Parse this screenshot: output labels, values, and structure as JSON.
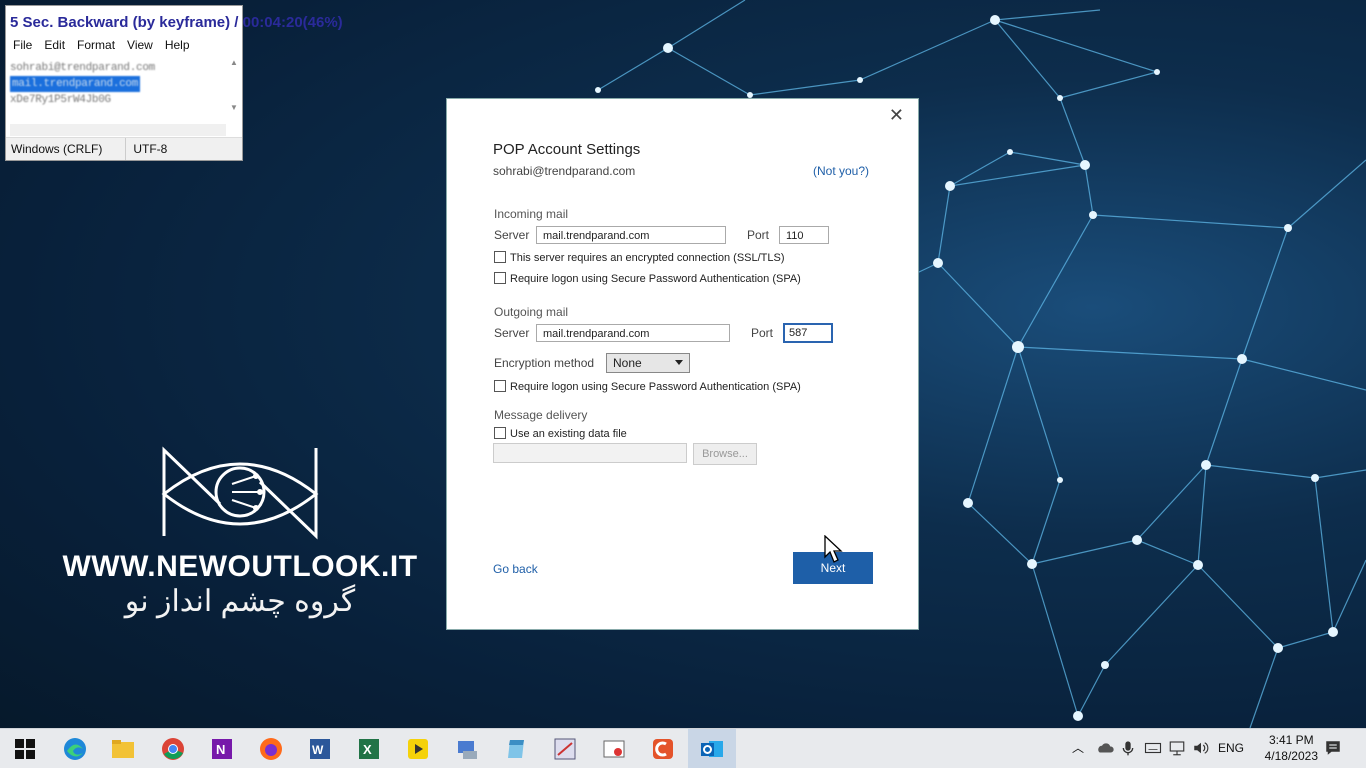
{
  "osd": {
    "text": "5 Sec. Backward (by keyframe) / 00:04:20(46%)"
  },
  "notepad": {
    "menu": [
      "File",
      "Edit",
      "Format",
      "View",
      "Help"
    ],
    "lines": [
      "sohrabi@trendparand.com",
      "mail.trendparand.com",
      "xDe7Ry1P5rW4Jb0G"
    ],
    "status_eol": "Windows (CRLF)",
    "status_encoding": "UTF-8"
  },
  "branding": {
    "url": "WWW.NEWOUTLOOK.IT",
    "tagline": "گروه چشم انداز نو"
  },
  "dialog": {
    "title": "POP Account Settings",
    "email": "sohrabi@trendparand.com",
    "not_you": "(Not you?)",
    "incoming": {
      "heading": "Incoming mail",
      "server_label": "Server",
      "server_value": "mail.trendparand.com",
      "port_label": "Port",
      "port_value": "110",
      "ssl_label": "This server requires an encrypted connection (SSL/TLS)",
      "ssl_checked": false,
      "spa_label": "Require logon using Secure Password Authentication (SPA)",
      "spa_checked": false
    },
    "outgoing": {
      "heading": "Outgoing mail",
      "server_label": "Server",
      "server_value": "mail.trendparand.com",
      "port_label": "Port",
      "port_value": "587",
      "encryption_label": "Encryption method",
      "encryption_value": "None",
      "spa_label": "Require logon using Secure Password Authentication (SPA)",
      "spa_checked": false
    },
    "delivery": {
      "heading": "Message delivery",
      "existing_label": "Use an existing data file",
      "existing_checked": false,
      "path_value": "",
      "browse_label": "Browse..."
    },
    "go_back": "Go back",
    "next": "Next"
  },
  "taskbar": {
    "apps": [
      "start-icon",
      "edge-icon",
      "file-explorer-icon",
      "chrome-icon",
      "onenote-icon",
      "firefox-icon",
      "word-icon",
      "excel-icon",
      "kmplayer-icon",
      "app-icon",
      "notepad-icon",
      "app-icon",
      "app-icon",
      "camtasia-icon",
      "outlook-icon"
    ],
    "active_app": "outlook-icon",
    "language": "ENG",
    "time": "3:41 PM",
    "date": "4/18/2023"
  },
  "colors": {
    "accent": "#1e5fa8",
    "link": "#1f5fa8",
    "desktop": "#0d2d4c"
  }
}
